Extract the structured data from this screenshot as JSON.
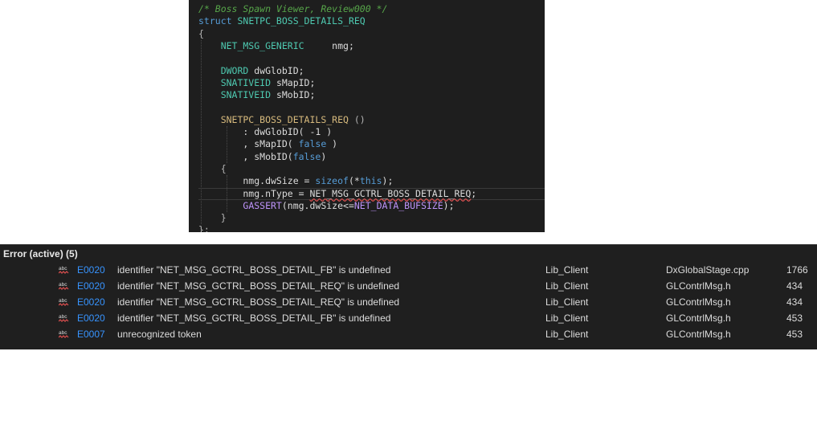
{
  "code_lines": [
    [
      {
        "t": "/* Boss Spawn Viewer, Review000 */",
        "c": "cm"
      }
    ],
    [
      {
        "t": "struct ",
        "c": "kw"
      },
      {
        "t": "SNETPC_BOSS_DETAILS_REQ",
        "c": "ty"
      }
    ],
    [
      {
        "t": "{",
        "c": "pu"
      }
    ],
    [
      {
        "t": "    NET_MSG_GENERIC",
        "c": "ty"
      },
      {
        "t": "     nmg;",
        "c": "id"
      }
    ],
    [],
    [
      {
        "t": "    DWORD ",
        "c": "ty"
      },
      {
        "t": "dwGlobID;",
        "c": "id"
      }
    ],
    [
      {
        "t": "    SNATIVEID ",
        "c": "ty"
      },
      {
        "t": "sMapID;",
        "c": "id"
      }
    ],
    [
      {
        "t": "    SNATIVEID ",
        "c": "ty"
      },
      {
        "t": "sMobID;",
        "c": "id"
      }
    ],
    [],
    [
      {
        "t": "    SNETPC_BOSS_DETAILS_REQ ",
        "c": "mac2"
      },
      {
        "t": "()",
        "c": "pu"
      }
    ],
    [
      {
        "t": "        : dwGlobID( -1 )",
        "c": "id"
      }
    ],
    [
      {
        "t": "        , sMapID( ",
        "c": "id"
      },
      {
        "t": "false",
        "c": "kw"
      },
      {
        "t": " )",
        "c": "id"
      }
    ],
    [
      {
        "t": "        , sMobID(",
        "c": "id"
      },
      {
        "t": "false",
        "c": "kw"
      },
      {
        "t": ")",
        "c": "id"
      }
    ],
    [
      {
        "t": "    {",
        "c": "pu"
      }
    ],
    [
      {
        "t": "        nmg.dwSize = ",
        "c": "id"
      },
      {
        "t": "sizeof",
        "c": "kw"
      },
      {
        "t": "(*",
        "c": "id"
      },
      {
        "t": "this",
        "c": "kw"
      },
      {
        "t": ");",
        "c": "id"
      }
    ],
    [
      {
        "t": "        nmg.nType = ",
        "c": "id"
      },
      {
        "t": "NET_MSG_GCTRL_BOSS_DETAIL_REQ",
        "c": "id err"
      },
      {
        "t": ";",
        "c": "id"
      }
    ],
    [
      {
        "t": "        ",
        "c": "id"
      },
      {
        "t": "GASSERT",
        "c": "mac"
      },
      {
        "t": "(nmg.dwSize<=",
        "c": "id"
      },
      {
        "t": "NET_DATA_BUFSIZE",
        "c": "mac"
      },
      {
        "t": ");",
        "c": "id"
      }
    ],
    [
      {
        "t": "    }",
        "c": "pu"
      }
    ],
    [
      {
        "t": "};",
        "c": "pu"
      }
    ]
  ],
  "error_list": {
    "title": "Error (active) (5)",
    "rows": [
      {
        "code": "E0020",
        "description": "identifier \"NET_MSG_GCTRL_BOSS_DETAIL_FB\" is undefined",
        "project": "Lib_Client",
        "file": "DxGlobalStage.cpp",
        "line": "1766"
      },
      {
        "code": "E0020",
        "description": "identifier \"NET_MSG_GCTRL_BOSS_DETAIL_REQ\" is undefined",
        "project": "Lib_Client",
        "file": "GLContrlMsg.h",
        "line": "434"
      },
      {
        "code": "E0020",
        "description": "identifier \"NET_MSG_GCTRL_BOSS_DETAIL_REQ\" is undefined",
        "project": "Lib_Client",
        "file": "GLContrlMsg.h",
        "line": "434"
      },
      {
        "code": "E0020",
        "description": "identifier \"NET_MSG_GCTRL_BOSS_DETAIL_FB\" is undefined",
        "project": "Lib_Client",
        "file": "GLContrlMsg.h",
        "line": "453"
      },
      {
        "code": "E0007",
        "description": "unrecognized token",
        "project": "Lib_Client",
        "file": "GLContrlMsg.h",
        "line": "453"
      }
    ]
  },
  "icons": {
    "error_row_icon": "abc-squiggle-icon"
  },
  "colors": {
    "editor_bg": "#1e1e1e",
    "error_code": "#3794ff",
    "squiggle": "#e05050"
  }
}
